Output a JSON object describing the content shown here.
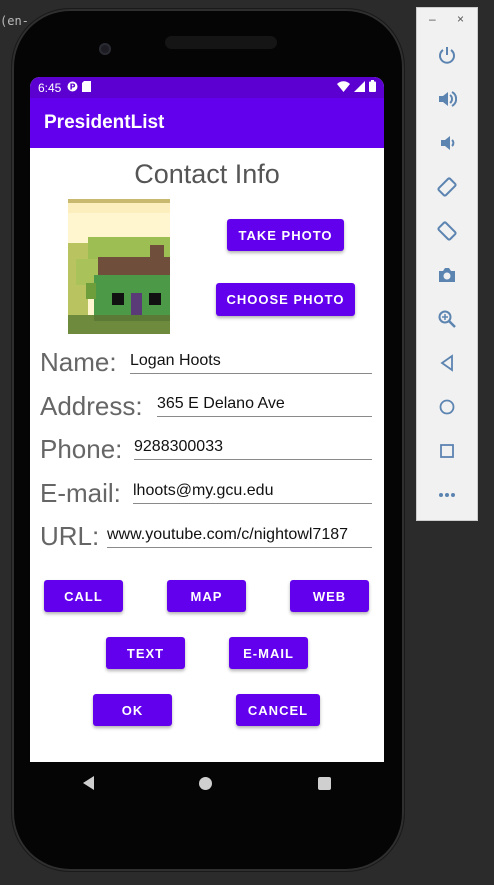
{
  "ide": {
    "fragment": "(en-"
  },
  "status_bar": {
    "time": "6:45",
    "icons": [
      "p-badge-icon",
      "sd-card-icon",
      "wifi-icon",
      "signal-icon",
      "battery-icon"
    ]
  },
  "app_bar": {
    "title": "PresidentList"
  },
  "contact": {
    "heading": "Contact Info",
    "take_photo": "TAKE PHOTO",
    "choose_photo": "CHOOSE PHOTO"
  },
  "fields": {
    "name": {
      "label": "Name:",
      "value": "Logan Hoots"
    },
    "address": {
      "label": "Address:",
      "value": "365 E Delano Ave"
    },
    "phone": {
      "label": "Phone:",
      "value": "9288300033"
    },
    "email": {
      "label": "E-mail:",
      "value": "lhoots@my.gcu.edu"
    },
    "url": {
      "label": "URL:",
      "value": "www.youtube.com/c/nightowl7187"
    }
  },
  "actions": {
    "call": "CALL",
    "map": "MAP",
    "web": "WEB",
    "text": "TEXT",
    "email": "E-MAIL",
    "ok": "OK",
    "cancel": "CANCEL"
  },
  "emulator_toolbar": {
    "minimize": "–",
    "close": "×",
    "tools": [
      "power-icon",
      "volume-up-icon",
      "volume-down-icon",
      "rotate-left-icon",
      "rotate-right-icon",
      "camera-icon",
      "zoom-icon",
      "back-icon",
      "home-icon",
      "overview-icon",
      "more-icon"
    ]
  },
  "colors": {
    "primary": "#6200ee",
    "status_bar": "#5b00d0",
    "emulator_icon": "#5c84b1"
  }
}
